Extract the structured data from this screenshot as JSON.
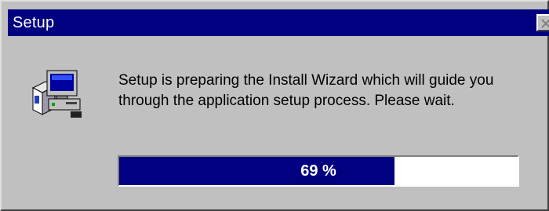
{
  "window": {
    "title": "Setup"
  },
  "message": {
    "line1": "Setup is preparing the Install Wizard which will guide you",
    "line2": "through the application setup process.  Please wait."
  },
  "progress": {
    "percent": 69,
    "label": "69 %"
  },
  "icons": {
    "close": "close-icon",
    "setup": "setup-computer-icon"
  },
  "colors": {
    "titlebar": "#000080",
    "progress_fill": "#000080",
    "face": "#c0c0c0"
  }
}
